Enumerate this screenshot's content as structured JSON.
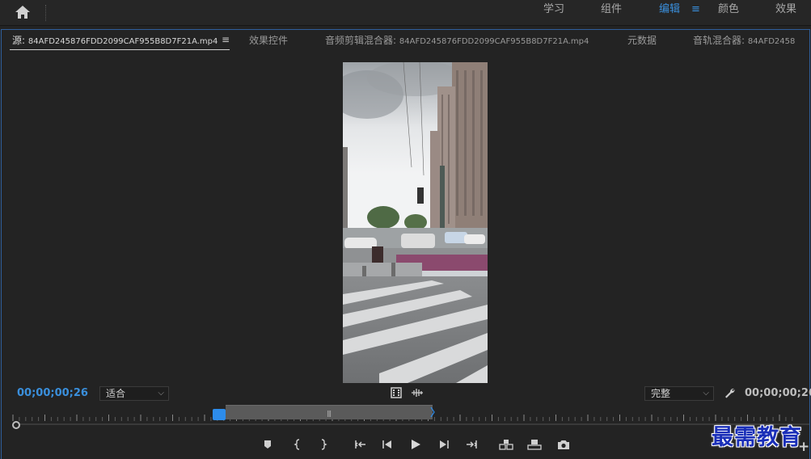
{
  "workspace": {
    "tabs": [
      {
        "label": "学习",
        "active": false
      },
      {
        "label": "组件",
        "active": false
      },
      {
        "label": "编辑",
        "active": true
      },
      {
        "label": "颜色",
        "active": false
      },
      {
        "label": "效果",
        "active": false
      }
    ],
    "menu_glyph": "≡"
  },
  "panel": {
    "tabs": {
      "source_prefix": "源:",
      "source_file": "84AFD245876FDD2099CAF955B8D7F21A.mp4",
      "menu_glyph": "≡",
      "effect_controls": "效果控件",
      "audio_clip_mixer_prefix": "音频剪辑混合器:",
      "audio_clip_mixer_file": "84AFD245876FDD2099CAF955B8D7F21A.mp4",
      "metadata": "元数据",
      "track_mixer_prefix": "音轨混合器:",
      "track_mixer_file": "84AFD2458"
    }
  },
  "controls": {
    "timecode_in": "00;00;00;26",
    "timecode_out": "00;00;00;26",
    "zoom_select": "适合",
    "quality_select": "完整",
    "chevron": "⌵"
  },
  "timeline": {
    "range_grip": "|||"
  },
  "transport": {
    "buttons": [
      "add-marker-icon",
      "mark-in-icon",
      "mark-out-icon",
      "go-to-in-icon",
      "step-back-icon",
      "play-icon",
      "step-forward-icon",
      "go-to-out-icon",
      "insert-icon",
      "overwrite-icon",
      "export-frame-icon"
    ]
  },
  "watermark": "最需教育",
  "add_button": "+",
  "colors": {
    "accent": "#3a8fdc",
    "panel_border": "#2f5e9c",
    "playhead": "#2d8ceb",
    "background": "#232323"
  }
}
